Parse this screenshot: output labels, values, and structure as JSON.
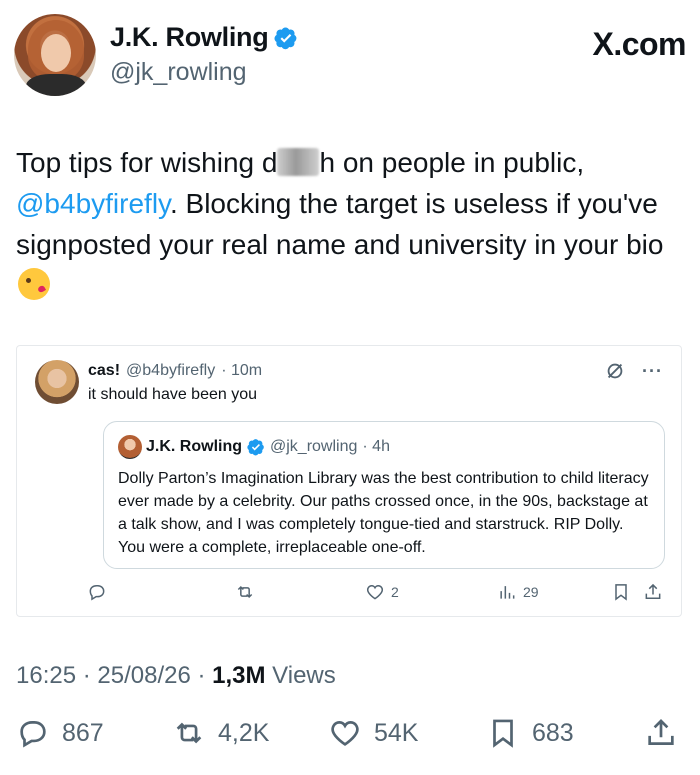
{
  "brand": {
    "site": "X.com"
  },
  "author": {
    "display_name": "J.K. Rowling",
    "handle": "@jk_rowling",
    "verified": true
  },
  "tweet": {
    "text_1": "Top tips for wishing d",
    "text_2": "h on people in public,",
    "mention": "@b4byfirefly",
    "text_3": ". Blocking the target is useless if you've signposted your real name and university in your bio",
    "emoji": "kissing-face-with-heart-emoji"
  },
  "quoted": {
    "display_name": "cas!",
    "handle": "@b4byfirefly",
    "time": "· 10m",
    "text": "it should have been you",
    "inner": {
      "display_name": "J.K. Rowling",
      "handle": "@jk_rowling",
      "time": "· 4h",
      "text": "Dolly Parton’s Imagination Library was the best contribution to child literacy ever made by a celebrity. Our paths crossed once, in the 90s, backstage at a talk show, and I was completely tongue-tied and starstruck. RIP Dolly. You were a complete, irreplaceable one-off."
    },
    "actions": {
      "likes": "2",
      "views": "29"
    }
  },
  "meta": {
    "time": "16:25",
    "date": "25/08/26",
    "views_count": "1,3M",
    "views_label": "Views"
  },
  "actions": {
    "replies": "867",
    "reposts": "4,2K",
    "likes": "54K",
    "bookmarks": "683"
  },
  "colors": {
    "accent": "#1d9bf0",
    "secondary_text": "#536471",
    "primary_text": "#0f1419"
  }
}
